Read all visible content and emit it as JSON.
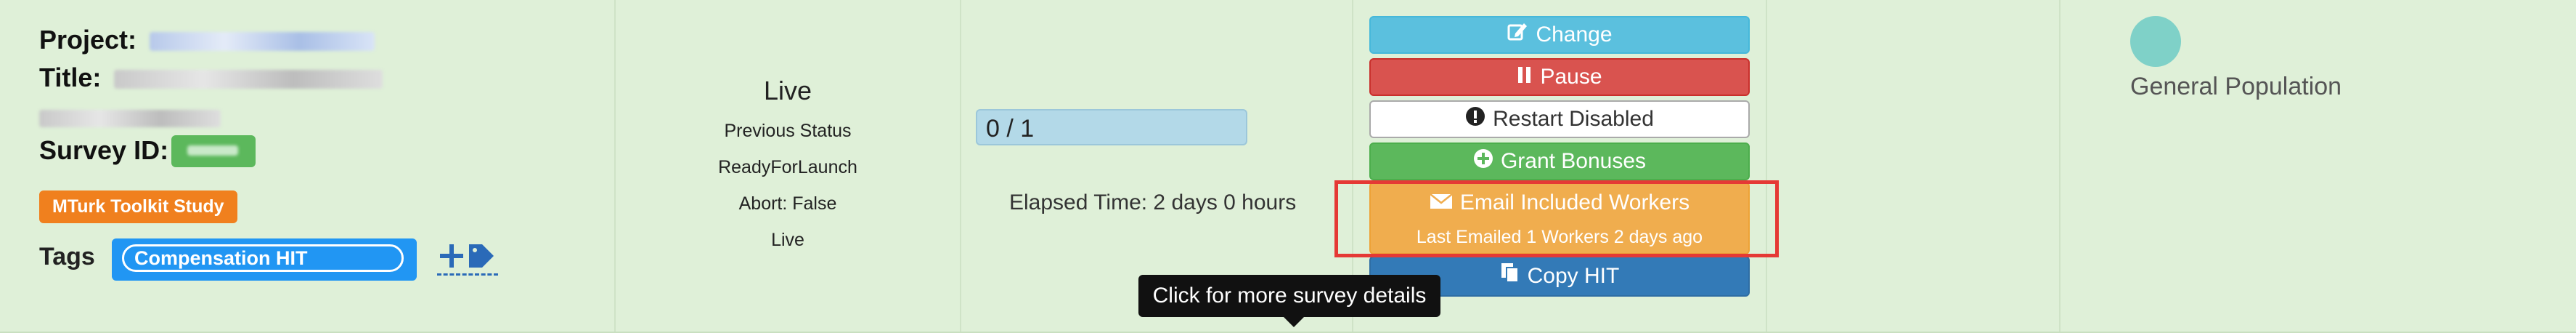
{
  "left": {
    "project_label": "Project:",
    "title_label": "Title:",
    "survey_id_label": "Survey ID:",
    "badge": "MTurk Toolkit Study",
    "tags_label": "Tags",
    "tag": "Compensation HIT",
    "add_tag_icon": "plus-tag-icon"
  },
  "status": {
    "current": "Live",
    "previous_label": "Previous Status",
    "previous_value": "ReadyForLaunch",
    "abort": "Abort: False",
    "live": "Live"
  },
  "progress": {
    "text": "0 / 1",
    "elapsed": "Elapsed Time: 2 days 0 hours"
  },
  "actions": {
    "change": "Change",
    "pause": "Pause",
    "restart": "Restart Disabled",
    "grant": "Grant Bonuses",
    "email": "Email Included Workers",
    "email_sub": "Last Emailed 1 Workers 2 days ago",
    "copy": "Copy HIT"
  },
  "tooltip": "Click for more survey details",
  "audience": {
    "label": "General Population"
  },
  "colors": {
    "info": "#5bc0de",
    "danger": "#d9534f",
    "success": "#5cb85c",
    "warning": "#f0ad4e",
    "primary": "#337ab7",
    "highlight": "#e53935"
  }
}
